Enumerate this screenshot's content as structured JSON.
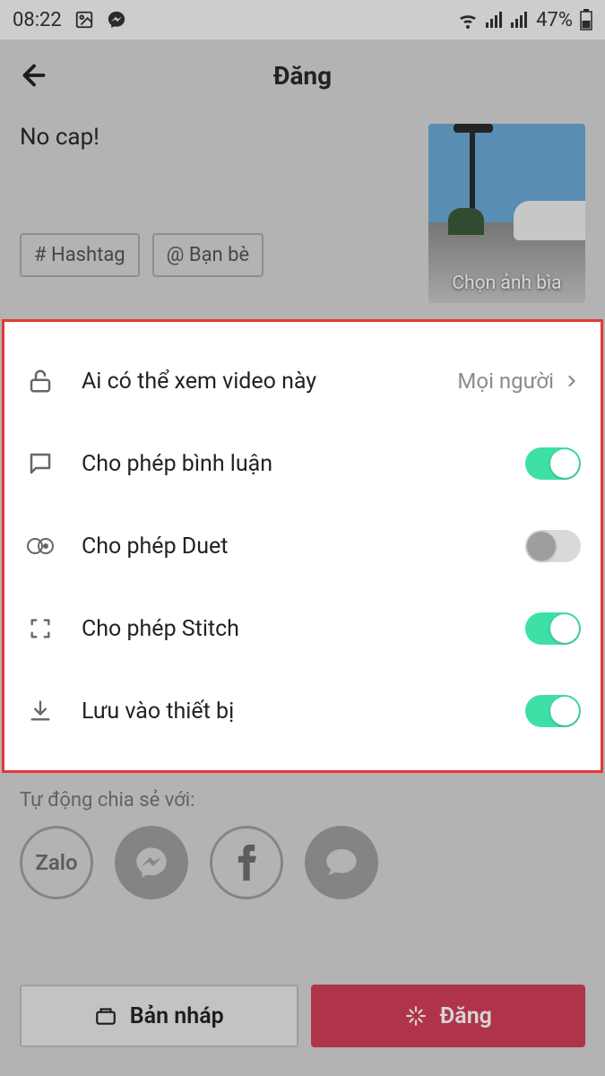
{
  "status": {
    "time": "08:22",
    "battery": "47%"
  },
  "header": {
    "title": "Đăng"
  },
  "compose": {
    "caption": "No cap!",
    "hashtag_label": "# Hashtag",
    "mention_label": "@ Bạn bè",
    "cover_label": "Chọn ảnh bìa"
  },
  "options": {
    "privacy": {
      "label": "Ai có thể xem video này",
      "value": "Mọi người"
    },
    "comments": {
      "label": "Cho phép bình luận",
      "on": true
    },
    "duet": {
      "label": "Cho phép Duet",
      "on": false
    },
    "stitch": {
      "label": "Cho phép Stitch",
      "on": true
    },
    "save": {
      "label": "Lưu vào thiết bị",
      "on": true
    }
  },
  "share": {
    "label": "Tự động chia sẻ với:",
    "zalo": "Zalo"
  },
  "buttons": {
    "draft": "Bản nháp",
    "post": "Đăng"
  }
}
